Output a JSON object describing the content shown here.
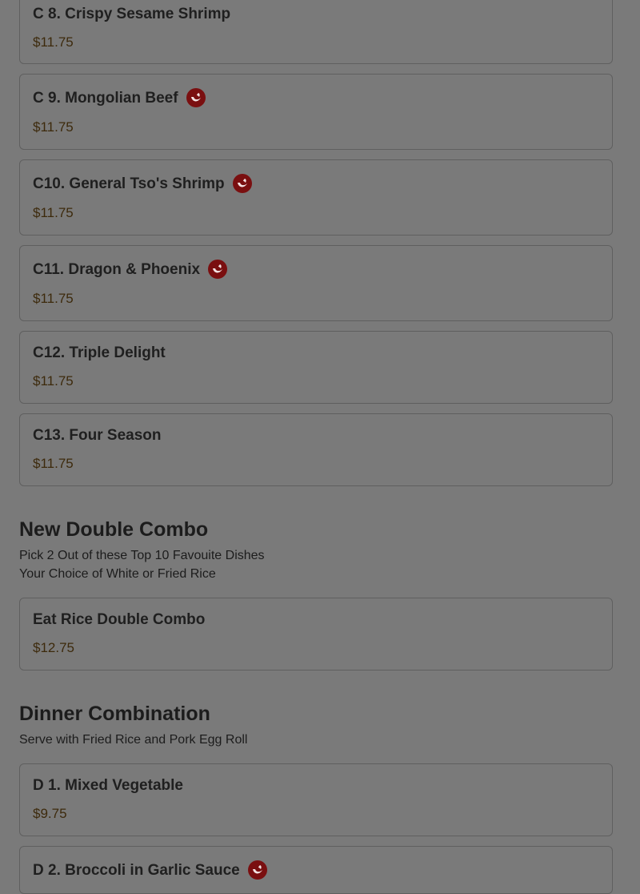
{
  "items": [
    {
      "name": "C 8. Crispy Sesame Shrimp",
      "price": "$11.75"
    },
    {
      "name": "C 9. Mongolian Beef",
      "price": "$11.75",
      "icon": "spicy-pepper-icon"
    },
    {
      "name": "C10. General Tso's Shrimp",
      "price": "$11.75",
      "icon": "spicy-pepper-icon"
    },
    {
      "name": "C11. Dragon & Phoenix",
      "price": "$11.75",
      "icon": "spicy-pepper-icon"
    },
    {
      "name": "C12. Triple Delight",
      "price": "$11.75"
    },
    {
      "name": "C13. Four Season",
      "price": "$11.75"
    }
  ],
  "double_combo": {
    "title": "New Double Combo",
    "desc_line1": "Pick 2 Out of these Top 10 Favouite Dishes",
    "desc_line2": "Your Choice of White or Fried Rice",
    "items": [
      {
        "name": "Eat Rice Double Combo",
        "price": "$12.75"
      }
    ]
  },
  "dinner_combo": {
    "title": "Dinner Combination",
    "desc": "Serve with Fried Rice and Pork Egg Roll",
    "items": [
      {
        "name": "D 1. Mixed Vegetable",
        "price": "$9.75"
      },
      {
        "name": "D 2. Broccoli in Garlic Sauce",
        "icon": "spicy-pepper-icon"
      }
    ]
  },
  "colors": {
    "overlay_background": "#7a7a7a",
    "spicy_icon": "#7a0f10",
    "price_text": "#3d2a0c"
  }
}
